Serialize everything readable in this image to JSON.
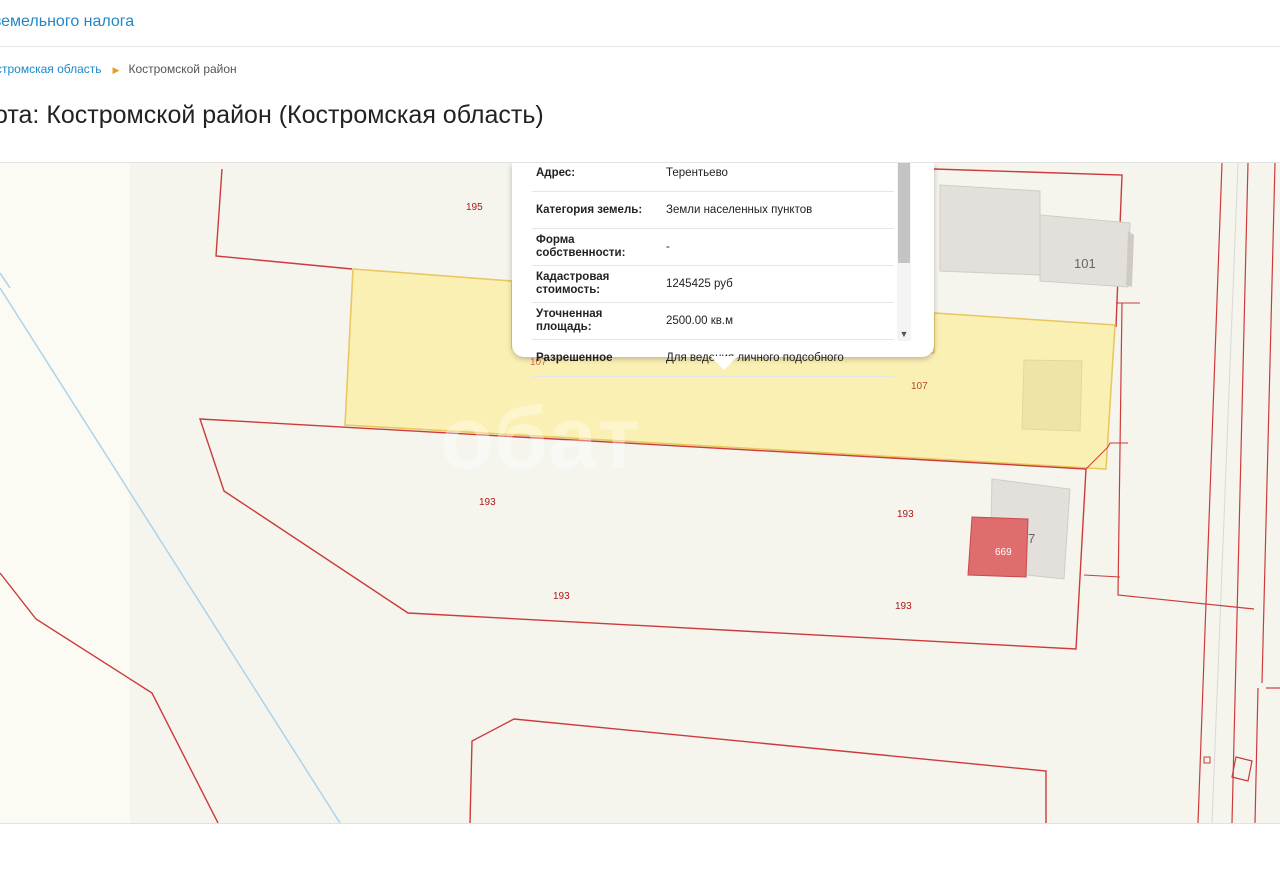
{
  "header": {
    "title": "земельного налога"
  },
  "breadcrumb": {
    "region": "стромская область",
    "district": "Костромской район"
  },
  "page_title": "ота: Костромской район (Костромская область)",
  "popup": {
    "rows": [
      {
        "key": "Адрес:",
        "value": "Терентьево"
      },
      {
        "key": "Категория земель:",
        "value": "Земли населенных пунктов"
      },
      {
        "key": "Форма собственности:",
        "value": "-"
      },
      {
        "key": "Кадастровая стоимость:",
        "value": "1245425 руб"
      },
      {
        "key": "Уточненная площадь:",
        "value": "2500.00 кв.м"
      },
      {
        "key": "Разрешенное",
        "value": "Для ведения личного подсобного"
      }
    ]
  },
  "map": {
    "parcel_labels": {
      "p195": "195",
      "p107a": "107",
      "p107b": "107",
      "p193a": "193",
      "p193b": "193",
      "p193c": "193",
      "p193d": "193",
      "p669": "669"
    },
    "building_labels": {
      "b101": "101",
      "b7": "7"
    },
    "watermark": "обат",
    "colors": {
      "boundary": "#cc3b3b",
      "selected_fill": "#fbf0b4",
      "selected_stroke": "#e8c860",
      "building": "#e3e0dc",
      "building_red": "#e06d6d",
      "water": "#a8d4ee"
    }
  }
}
